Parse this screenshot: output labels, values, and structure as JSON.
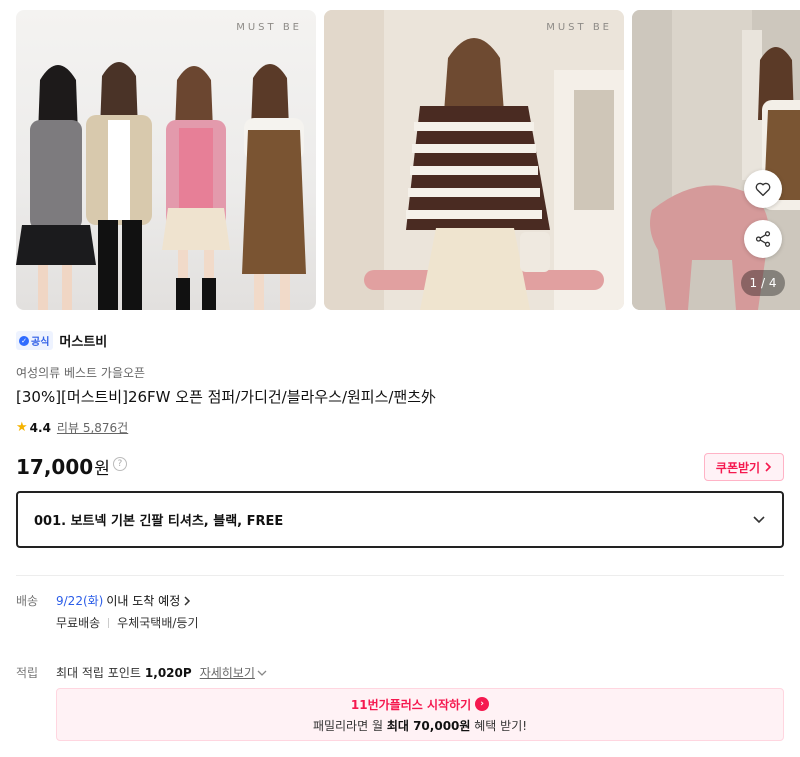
{
  "gallery": {
    "watermark": "MUST BE",
    "counter": "1 / 4",
    "like_icon": "heart-icon",
    "share_icon": "share-icon"
  },
  "seller": {
    "badge": "공식",
    "name": "머스트비"
  },
  "product": {
    "category": "여성의류 베스트 가을오픈",
    "title": "[30%][머스트비]26FW 오픈 점퍼/가디건/블라우스/원피스/팬츠外",
    "rating": "4.4",
    "review_label": "리뷰 5,876건",
    "price": "17,000",
    "currency": "원",
    "coupon_label": "쿠폰받기"
  },
  "option": {
    "selected": "001. 보트넥 기본 긴팔 티셔츠, 블랙, FREE"
  },
  "delivery": {
    "label": "배송",
    "date": "9/22(화)",
    "date_suffix": "이내 도착 예정",
    "fee": "무료배송",
    "carrier": "우체국택배/등기"
  },
  "points": {
    "label": "적립",
    "text": "최대 적립 포인트",
    "amount": "1,020P",
    "detail": "자세히보기"
  },
  "plus": {
    "title": "11번가플러스 시작하기",
    "sub_prefix": "패밀리라면 월",
    "sub_bold": "최대 70,000원",
    "sub_suffix": "혜택 받기!"
  },
  "colors": {
    "accent": "#f5194f",
    "link_blue": "#2b5de8",
    "star": "#f5b301"
  }
}
